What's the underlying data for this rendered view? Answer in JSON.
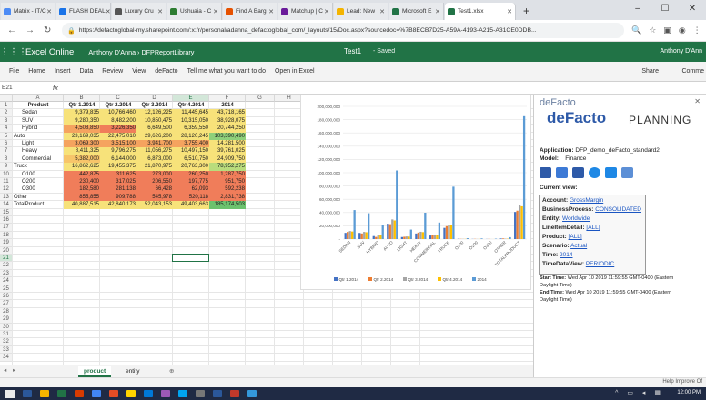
{
  "browser": {
    "tabs": [
      {
        "label": "Matrix - IT/C",
        "color": "#4c8bf5"
      },
      {
        "label": "FLASH DEAL",
        "color": "#1a73e8"
      },
      {
        "label": "Luxury Cru",
        "color": "#555555"
      },
      {
        "label": "Ushuaia - C",
        "color": "#2e7d32"
      },
      {
        "label": "Find A Barg",
        "color": "#e65100"
      },
      {
        "label": "Matchup | C",
        "color": "#6a1b9a"
      },
      {
        "label": "Lead: New",
        "color": "#f4b400"
      },
      {
        "label": "Microsoft E",
        "color": "#217346"
      },
      {
        "label": "Test1.xlsx",
        "color": "#217346"
      }
    ],
    "url": "https://defactoglobal-my.sharepoint.com/:x:/r/personal/adanna_defactoglobal_com/_layouts/15/Doc.aspx?sourcedoc=%7B8ECB7D25-A59A-4193-A215-A31CE0DDB..."
  },
  "office": {
    "app": "Excel Online",
    "breadcrumb": "Anthony D'Anna › DFPReportLibrary",
    "doc": "Test1",
    "saved": "-  Saved",
    "user": "Anthony D'Ann"
  },
  "ribbon": {
    "items": [
      "File",
      "Home",
      "Insert",
      "Data",
      "Review",
      "View",
      "deFacto"
    ],
    "tell": "Tell me what you want to do",
    "open": "Open in Excel",
    "share": "Share",
    "comments": "Comme"
  },
  "formula": {
    "namebox": "E21",
    "fx": "fx"
  },
  "columns": [
    "A",
    "B",
    "C",
    "D",
    "E",
    "F",
    "G",
    "H",
    "I",
    "J",
    "K",
    "L",
    "M",
    "N"
  ],
  "table": {
    "headers": [
      "Product",
      "Qtr 1.2014",
      "Qtr 2.2014",
      "Qtr 3.2014",
      "Qtr 4.2014",
      "2014"
    ],
    "rows": [
      {
        "label": "Sedan",
        "indent": 1,
        "v": [
          "9,379,835",
          "10,766,460",
          "12,126,225",
          "11,445,645",
          "43,718,165"
        ],
        "c": [
          "#f7e27a",
          "#f7e27a",
          "#f7e27a",
          "#f7e27a",
          "#f7e27a"
        ]
      },
      {
        "label": "SUV",
        "indent": 1,
        "v": [
          "9,280,350",
          "8,482,200",
          "10,850,475",
          "10,315,050",
          "38,928,075"
        ],
        "c": [
          "#f7e27a",
          "#f7e27a",
          "#f7e27a",
          "#f7e27a",
          "#f7e27a"
        ]
      },
      {
        "label": "Hybrid",
        "indent": 1,
        "v": [
          "4,508,850",
          "3,226,350",
          "6,649,500",
          "6,359,550",
          "20,744,250"
        ],
        "c": [
          "#f5a35f",
          "#f07d5a",
          "#f7e27a",
          "#f7e27a",
          "#f7e27a"
        ]
      },
      {
        "label": "Auto",
        "indent": 0,
        "v": [
          "23,169,035",
          "22,475,010",
          "29,626,200",
          "28,120,245",
          "103,390,490"
        ],
        "c": [
          "#f7e27a",
          "#f7e27a",
          "#f7e27a",
          "#f7e27a",
          "#8ed07a"
        ]
      },
      {
        "label": "Light",
        "indent": 1,
        "v": [
          "3,069,300",
          "3,515,100",
          "3,941,700",
          "3,755,400",
          "14,281,500"
        ],
        "c": [
          "#f5a35f",
          "#f5a35f",
          "#f5a35f",
          "#f5a35f",
          "#f7e27a"
        ]
      },
      {
        "label": "Heavy",
        "indent": 1,
        "v": [
          "8,411,325",
          "9,796,275",
          "11,056,275",
          "10,497,150",
          "39,761,025"
        ],
        "c": [
          "#f7e27a",
          "#f7e27a",
          "#f7e27a",
          "#f7e27a",
          "#f7e27a"
        ]
      },
      {
        "label": "Commercial",
        "indent": 1,
        "v": [
          "5,382,000",
          "6,144,000",
          "6,873,000",
          "6,510,750",
          "24,909,750"
        ],
        "c": [
          "#f7c56a",
          "#f7e27a",
          "#f7e27a",
          "#f7e27a",
          "#f7e27a"
        ]
      },
      {
        "label": "Truck",
        "indent": 0,
        "v": [
          "16,862,625",
          "19,455,375",
          "21,870,975",
          "20,763,300",
          "78,952,275"
        ],
        "c": [
          "#f7e27a",
          "#f7e27a",
          "#f7e27a",
          "#f7e27a",
          "#b9dc7c"
        ]
      },
      {
        "label": "O100",
        "indent": 1,
        "v": [
          "442,875",
          "311,625",
          "273,000",
          "260,250",
          "1,287,750"
        ],
        "c": [
          "#f07d5a",
          "#f07d5a",
          "#f07d5a",
          "#f07d5a",
          "#f07d5a"
        ]
      },
      {
        "label": "O200",
        "indent": 1,
        "v": [
          "230,400",
          "317,025",
          "206,550",
          "197,775",
          "951,750"
        ],
        "c": [
          "#f07d5a",
          "#f07d5a",
          "#f07d5a",
          "#f07d5a",
          "#f07d5a"
        ]
      },
      {
        "label": "O300",
        "indent": 1,
        "v": [
          "182,580",
          "281,138",
          "66,428",
          "62,093",
          "592,238"
        ],
        "c": [
          "#f07d5a",
          "#f07d5a",
          "#f07d5a",
          "#f07d5a",
          "#f07d5a"
        ]
      },
      {
        "label": "Other",
        "indent": 0,
        "v": [
          "855,855",
          "909,788",
          "545,978",
          "520,118",
          "2,831,738"
        ],
        "c": [
          "#f07d5a",
          "#f07d5a",
          "#f07d5a",
          "#f07d5a",
          "#f07d5a"
        ]
      },
      {
        "label": "TotalProduct",
        "indent": 0,
        "v": [
          "40,887,515",
          "42,840,173",
          "52,043,153",
          "49,403,663",
          "185,174,503"
        ],
        "c": [
          "#f7e27a",
          "#f7e27a",
          "#f7e27a",
          "#f7e27a",
          "#6cc26e"
        ]
      }
    ]
  },
  "chart_data": {
    "type": "bar",
    "categories": [
      "SEDAN",
      "SUV",
      "HYBRID",
      "AUTO",
      "LIGHT",
      "HEAVY",
      "COMMERCIAL",
      "TRUCK",
      "O100",
      "O200",
      "O300",
      "OTHER",
      "TOTALPRODUCT"
    ],
    "series": [
      {
        "name": "Qtr 1.2014",
        "color": "#4472c4",
        "values": [
          9379835,
          9280350,
          4508850,
          23169035,
          3069300,
          8411325,
          5382000,
          16862625,
          442875,
          230400,
          182580,
          855855,
          40887515
        ]
      },
      {
        "name": "Qtr 2.2014",
        "color": "#ed7d31",
        "values": [
          10766460,
          8482200,
          3226350,
          22475010,
          3515100,
          9796275,
          6144000,
          19455375,
          311625,
          317025,
          281138,
          909788,
          42840173
        ]
      },
      {
        "name": "Qtr 3.2014",
        "color": "#a5a5a5",
        "values": [
          12126225,
          10850475,
          6649500,
          29626200,
          3941700,
          11056275,
          6873000,
          21870975,
          273000,
          206550,
          66428,
          545978,
          52043153
        ]
      },
      {
        "name": "Qtr 4.2014",
        "color": "#ffc000",
        "values": [
          11445645,
          10315050,
          6359550,
          28120245,
          3755400,
          10497150,
          6510750,
          20763300,
          260250,
          197775,
          62093,
          520118,
          49403663
        ]
      },
      {
        "name": "2014",
        "color": "#5b9bd5",
        "values": [
          43718165,
          38928075,
          20744250,
          103390490,
          14281500,
          39761025,
          24909750,
          78952275,
          1287750,
          951750,
          592238,
          2831738,
          185174503
        ]
      }
    ],
    "ylim": [
      0,
      200000000
    ],
    "yticks": [
      "-",
      "20,000,000",
      "40,000,000",
      "60,000,000",
      "80,000,000",
      "100,000,000",
      "120,000,000",
      "140,000,000",
      "160,000,000",
      "180,000,000",
      "200,000,000"
    ],
    "legend": "bottom",
    "grid": true
  },
  "pane": {
    "brand_small": "deFacto",
    "brand_big": "deFacto",
    "brand_planning": "PLANNING",
    "application_label": "Application:",
    "application": "DFP_demo_deFacto_standard2",
    "model_label": "Model:",
    "model": "Finance",
    "current_view": "Current view:",
    "account_label": "Account:",
    "account": "GrossMargin",
    "bp_label": "BusinessProcess:",
    "bp": "CONSOLIDATED",
    "entity_label": "Entity:",
    "entity": "Worldwide",
    "lid_label": "LineItemDetail:",
    "lid": "[ALL]",
    "product_label": "Product:",
    "product": "[ALL]",
    "scenario_label": "Scenario:",
    "scenario": "Actual",
    "time_label": "Time:",
    "time": "2014",
    "tdv_label": "TimeDataView:",
    "tdv": "PERIODIC",
    "start_label": "Start Time:",
    "start": "Wed Apr 10 2019 11:59:55 GMT-0400 (Eastern",
    "start2": "Daylight Time)",
    "end_label": "End Time:",
    "end": "Wed Apr 10 2019 11:59:55 GMT-0400 (Eastern",
    "end2": "Daylight Time)"
  },
  "sheets": {
    "tabs": [
      "product",
      "entity"
    ],
    "add": "⊕"
  },
  "status": {
    "help": "Help Improve Of"
  },
  "taskbar": {
    "time": "12:00 PM"
  }
}
